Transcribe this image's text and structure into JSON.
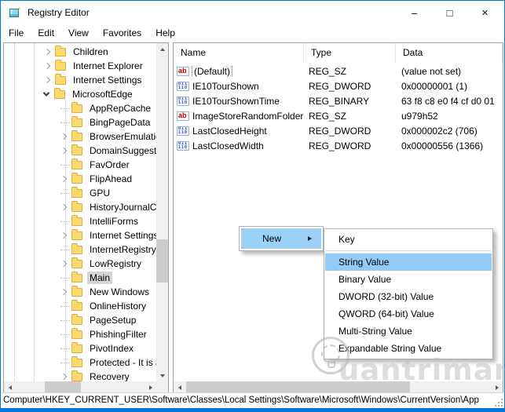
{
  "window": {
    "title": "Registry Editor",
    "controls": {
      "minimize": "–",
      "maximize": "□",
      "close": "×"
    }
  },
  "menu_bar": {
    "items": [
      "File",
      "Edit",
      "View",
      "Favorites",
      "Help"
    ]
  },
  "tree": {
    "items": [
      {
        "label": "Children",
        "level": 1,
        "state": "collapsed"
      },
      {
        "label": "Internet Explorer",
        "level": 1,
        "state": "collapsed"
      },
      {
        "label": "Internet Settings",
        "level": 1,
        "state": "collapsed"
      },
      {
        "label": "MicrosoftEdge",
        "level": 1,
        "state": "expanded"
      },
      {
        "label": "AppRepCache",
        "level": 2,
        "state": "leaf"
      },
      {
        "label": "BingPageData",
        "level": 2,
        "state": "leaf"
      },
      {
        "label": "BrowserEmulatio",
        "level": 2,
        "state": "collapsed"
      },
      {
        "label": "DomainSuggesti",
        "level": 2,
        "state": "collapsed"
      },
      {
        "label": "FavOrder",
        "level": 2,
        "state": "leaf"
      },
      {
        "label": "FlipAhead",
        "level": 2,
        "state": "collapsed"
      },
      {
        "label": "GPU",
        "level": 2,
        "state": "leaf"
      },
      {
        "label": "HistoryJournalCe",
        "level": 2,
        "state": "collapsed"
      },
      {
        "label": "IntelliForms",
        "level": 2,
        "state": "leaf"
      },
      {
        "label": "Internet Settings",
        "level": 2,
        "state": "collapsed"
      },
      {
        "label": "InternetRegistry",
        "level": 2,
        "state": "leaf"
      },
      {
        "label": "LowRegistry",
        "level": 2,
        "state": "collapsed"
      },
      {
        "label": "Main",
        "level": 2,
        "state": "leaf",
        "selected": true
      },
      {
        "label": "New Windows",
        "level": 2,
        "state": "collapsed"
      },
      {
        "label": "OnlineHistory",
        "level": 2,
        "state": "leaf"
      },
      {
        "label": "PageSetup",
        "level": 2,
        "state": "leaf"
      },
      {
        "label": "PhishingFilter",
        "level": 2,
        "state": "leaf"
      },
      {
        "label": "PivotIndex",
        "level": 2,
        "state": "leaf"
      },
      {
        "label": "Protected - It is a",
        "level": 2,
        "state": "leaf"
      },
      {
        "label": "Recovery",
        "level": 2,
        "state": "collapsed"
      }
    ]
  },
  "list": {
    "columns": [
      "Name",
      "Type",
      "Data"
    ],
    "rows": [
      {
        "icon": "string",
        "name": "(Default)",
        "type": "REG_SZ",
        "data": "(value not set)",
        "focused": true
      },
      {
        "icon": "dword",
        "name": "IE10TourShown",
        "type": "REG_DWORD",
        "data": "0x00000001 (1)"
      },
      {
        "icon": "binary",
        "name": "IE10TourShownTime",
        "type": "REG_BINARY",
        "data": "63 f8 c8 e0 f4 cf d0 01"
      },
      {
        "icon": "string",
        "name": "ImageStoreRandomFolder",
        "type": "REG_SZ",
        "data": "u979h52"
      },
      {
        "icon": "dword",
        "name": "LastClosedHeight",
        "type": "REG_DWORD",
        "data": "0x000002c2 (706)"
      },
      {
        "icon": "dword",
        "name": "LastClosedWidth",
        "type": "REG_DWORD",
        "data": "0x00000556 (1366)"
      }
    ]
  },
  "context_menu": {
    "items": [
      {
        "label": "New",
        "has_submenu": true,
        "highlighted": true
      }
    ]
  },
  "submenu": {
    "items": [
      "Key",
      "String Value",
      "Binary Value",
      "DWORD (32-bit) Value",
      "QWORD (64-bit) Value",
      "Multi-String Value",
      "Expandable String Value"
    ],
    "highlighted_index": 1,
    "separator_after_index": 0
  },
  "status_bar": {
    "path": "Computer\\HKEY_CURRENT_USER\\Software\\Classes\\Local Settings\\Software\\Microsoft\\Windows\\CurrentVersion\\App"
  },
  "watermark": {
    "text": "uantrimang"
  },
  "colors": {
    "accent": "#0078d7",
    "menu_highlight": "#94cbf6",
    "inactive_selection": "#d4d4d4",
    "folder": "#fcd96e",
    "scrollbar_track": "#f0f0f0",
    "scrollbar_thumb": "#cdcdcd"
  }
}
